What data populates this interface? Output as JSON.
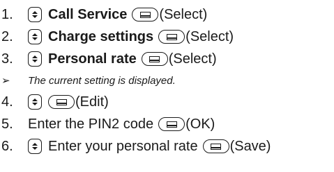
{
  "steps": [
    {
      "num": "1.",
      "label": "Call Service",
      "action": "(Select)"
    },
    {
      "num": "2.",
      "label": "Charge settings",
      "action": "(Select)"
    },
    {
      "num": "3.",
      "label": "Personal rate",
      "action": "(Select)"
    },
    {
      "num": "4.",
      "action": "(Edit)"
    },
    {
      "num": "5.",
      "text": "Enter the PIN2 code",
      "action": "(OK)"
    },
    {
      "num": "6.",
      "text": "Enter your personal rate",
      "action": "(Save)"
    }
  ],
  "note": {
    "arrow": "➢",
    "text": "The current setting is displayed."
  },
  "icons": {
    "nav_key": "up-down-nav-key-icon",
    "softkey": "softkey-icon"
  }
}
